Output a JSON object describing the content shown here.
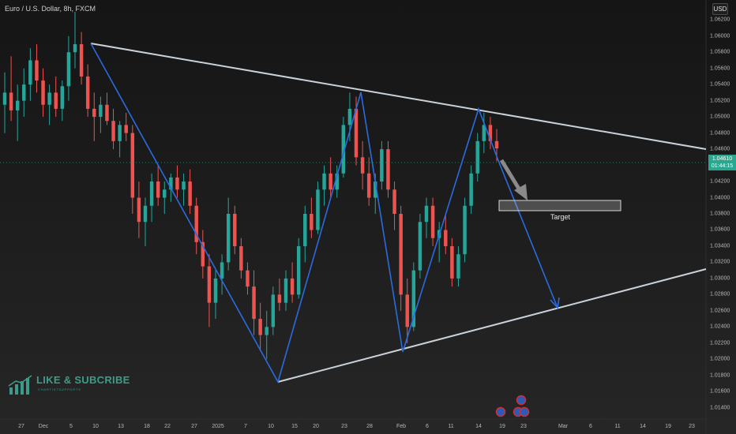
{
  "header": {
    "symbol_title": "Euro / U.S. Dollar, 8h, FXCM",
    "currency_button": "USD"
  },
  "price_tag": {
    "price": "1.04610",
    "countdown": "01:44:15",
    "color": "#2aa88f"
  },
  "target_label": "Target",
  "branding": {
    "title": "LIKE & SUBCRIBE",
    "subtitle": "CHARTISTSUPPORTS",
    "color": "#3a9d8a"
  },
  "colors": {
    "up_candle": "#26a69a",
    "down_candle": "#ef5350",
    "zigzag": "#2b6be0",
    "trendline": "#c9d1d9",
    "target_box": "#cfcfcf"
  },
  "event_icons": [
    "eu-flag-icon",
    "eu-flag-icon",
    "us-flag-icon",
    "us-flag-icon"
  ],
  "chart_data": {
    "type": "candlestick",
    "title": "Euro / U.S. Dollar, 8h, FXCM",
    "ylabel": "USD",
    "ylim": [
      1.013,
      1.063
    ],
    "y_ticks": [
      "1.06200",
      "1.06000",
      "1.05800",
      "1.05600",
      "1.05400",
      "1.05200",
      "1.05000",
      "1.04800",
      "1.04600",
      "1.04200",
      "1.04000",
      "1.03800",
      "1.03600",
      "1.03400",
      "1.03200",
      "1.03000",
      "1.02800",
      "1.02600",
      "1.02400",
      "1.02200",
      "1.02000",
      "1.01800",
      "1.01600",
      "1.01400"
    ],
    "x_ticks": [
      "27",
      "Dec",
      "5",
      "10",
      "13",
      "18",
      "22",
      "27",
      "2025",
      "7",
      "10",
      "15",
      "20",
      "23",
      "28",
      "Feb",
      "6",
      "11",
      "14",
      "19",
      "23",
      "Mar",
      "6",
      "11",
      "14",
      "19",
      "23"
    ],
    "last_price": 1.0461,
    "grid": false,
    "candles": [
      [
        1.0515,
        1.0555,
        1.048,
        1.053
      ],
      [
        1.053,
        1.0575,
        1.0495,
        1.0508
      ],
      [
        1.0508,
        1.054,
        1.047,
        1.052
      ],
      [
        1.052,
        1.056,
        1.05,
        1.054
      ],
      [
        1.054,
        1.0585,
        1.052,
        1.057
      ],
      [
        1.057,
        1.059,
        1.053,
        1.0545
      ],
      [
        1.0545,
        1.056,
        1.05,
        1.0515
      ],
      [
        1.0515,
        1.054,
        1.049,
        1.053
      ],
      [
        1.053,
        1.055,
        1.05,
        1.051
      ],
      [
        1.051,
        1.0545,
        1.0495,
        1.0538
      ],
      [
        1.0538,
        1.06,
        1.052,
        1.058
      ],
      [
        1.058,
        1.063,
        1.056,
        1.059
      ],
      [
        1.059,
        1.0605,
        1.054,
        1.055
      ],
      [
        1.055,
        1.0565,
        1.05,
        1.051
      ],
      [
        1.051,
        1.053,
        1.047,
        1.05
      ],
      [
        1.05,
        1.0525,
        1.048,
        1.0515
      ],
      [
        1.0515,
        1.053,
        1.049,
        1.0495
      ],
      [
        1.0495,
        1.051,
        1.046,
        1.047
      ],
      [
        1.047,
        1.0495,
        1.045,
        1.049
      ],
      [
        1.049,
        1.0505,
        1.047,
        1.048
      ],
      [
        1.048,
        1.049,
        1.038,
        1.04
      ],
      [
        1.04,
        1.042,
        1.035,
        1.037
      ],
      [
        1.037,
        1.04,
        1.034,
        1.039
      ],
      [
        1.039,
        1.043,
        1.037,
        1.042
      ],
      [
        1.042,
        1.044,
        1.039,
        1.04
      ],
      [
        1.04,
        1.042,
        1.038,
        1.041
      ],
      [
        1.041,
        1.043,
        1.0395,
        1.0425
      ],
      [
        1.0425,
        1.044,
        1.04,
        1.041
      ],
      [
        1.041,
        1.043,
        1.039,
        1.042
      ],
      [
        1.042,
        1.0435,
        1.038,
        1.039
      ],
      [
        1.039,
        1.04,
        1.033,
        1.0345
      ],
      [
        1.0345,
        1.036,
        1.03,
        1.0315
      ],
      [
        1.0315,
        1.033,
        1.024,
        1.027
      ],
      [
        1.027,
        1.031,
        1.025,
        1.03
      ],
      [
        1.03,
        1.033,
        1.028,
        1.032
      ],
      [
        1.032,
        1.04,
        1.031,
        1.038
      ],
      [
        1.038,
        1.039,
        1.033,
        1.034
      ],
      [
        1.034,
        1.035,
        1.03,
        1.031
      ],
      [
        1.031,
        1.032,
        1.028,
        1.029
      ],
      [
        1.029,
        1.031,
        1.023,
        1.025
      ],
      [
        1.025,
        1.027,
        1.021,
        1.023
      ],
      [
        1.023,
        1.026,
        1.02,
        1.024
      ],
      [
        1.024,
        1.029,
        1.023,
        1.028
      ],
      [
        1.028,
        1.03,
        1.026,
        1.027
      ],
      [
        1.027,
        1.031,
        1.026,
        1.03
      ],
      [
        1.03,
        1.032,
        1.027,
        1.028
      ],
      [
        1.028,
        1.035,
        1.0275,
        1.034
      ],
      [
        1.034,
        1.039,
        1.032,
        1.038
      ],
      [
        1.038,
        1.04,
        1.035,
        1.036
      ],
      [
        1.036,
        1.042,
        1.0355,
        1.041
      ],
      [
        1.041,
        1.044,
        1.039,
        1.043
      ],
      [
        1.043,
        1.045,
        1.04,
        1.041
      ],
      [
        1.041,
        1.044,
        1.04,
        1.043
      ],
      [
        1.043,
        1.05,
        1.0425,
        1.049
      ],
      [
        1.049,
        1.053,
        1.047,
        1.051
      ],
      [
        1.051,
        1.0525,
        1.044,
        1.045
      ],
      [
        1.045,
        1.047,
        1.041,
        1.043
      ],
      [
        1.043,
        1.045,
        1.039,
        1.04
      ],
      [
        1.04,
        1.043,
        1.038,
        1.042
      ],
      [
        1.042,
        1.047,
        1.041,
        1.046
      ],
      [
        1.046,
        1.047,
        1.04,
        1.041
      ],
      [
        1.041,
        1.042,
        1.036,
        1.038
      ],
      [
        1.038,
        1.039,
        1.026,
        1.028
      ],
      [
        1.028,
        1.03,
        1.022,
        1.024
      ],
      [
        1.024,
        1.032,
        1.0235,
        1.031
      ],
      [
        1.031,
        1.038,
        1.03,
        1.037
      ],
      [
        1.037,
        1.04,
        1.035,
        1.039
      ],
      [
        1.039,
        1.04,
        1.034,
        1.035
      ],
      [
        1.035,
        1.037,
        1.032,
        1.036
      ],
      [
        1.036,
        1.038,
        1.033,
        1.034
      ],
      [
        1.034,
        1.035,
        1.029,
        1.03
      ],
      [
        1.03,
        1.034,
        1.029,
        1.033
      ],
      [
        1.033,
        1.04,
        1.032,
        1.039
      ],
      [
        1.039,
        1.044,
        1.038,
        1.043
      ],
      [
        1.043,
        1.048,
        1.042,
        1.047
      ],
      [
        1.047,
        1.0505,
        1.0455,
        1.049
      ],
      [
        1.049,
        1.05,
        1.046,
        1.047
      ],
      [
        1.047,
        1.0485,
        1.0445,
        1.0461
      ]
    ],
    "annotations": {
      "upper_trendline": [
        [
          0.0,
          1.0595
        ],
        [
          1.0,
          1.0465
        ]
      ],
      "lower_trendline": [
        [
          0.285,
          1.0181
        ],
        [
          1.0,
          1.0315
        ]
      ],
      "zigzag": [
        1.0595,
        1.0182,
        1.053,
        1.0217,
        1.0513,
        1.027
      ],
      "target_zone": [
        1.0388,
        1.0402
      ],
      "target_label": "Target"
    }
  }
}
